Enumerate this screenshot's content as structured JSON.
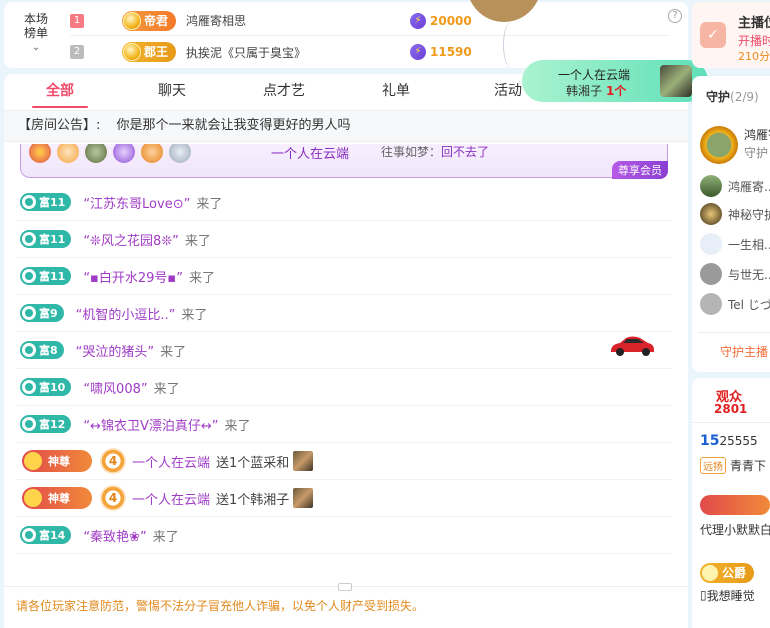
{
  "rank": {
    "title": "本场\n榜单",
    "title_line1": "本场",
    "title_line2": "榜单",
    "chevron": "⌄",
    "help": "?",
    "rows": [
      {
        "num": "1",
        "badge": "帝君",
        "name": "鸿雁寄相思",
        "score": "20000"
      },
      {
        "num": "2",
        "badge": "郡王",
        "name": "执挨泥《只属于臭宝》",
        "score": "11590"
      }
    ]
  },
  "tabs": [
    "全部",
    "聊天",
    "点才艺",
    "礼单",
    "活动"
  ],
  "active_tab": "全部",
  "announcement": {
    "label": "【房间公告】:",
    "text": "你是那个一来就会让我变得更好的男人吗"
  },
  "vip_banner": {
    "user": "一个人在云端",
    "msg_prefix": "往事如梦：",
    "msg_text": "回不去了",
    "tag": "尊享会员"
  },
  "messages": [
    {
      "type": "enter",
      "fu": "富11",
      "user": "“江苏东哥Love⊙”",
      "action": "来了"
    },
    {
      "type": "enter",
      "fu": "富11",
      "user": "“❊风之花园8❊”",
      "action": "来了"
    },
    {
      "type": "enter",
      "fu": "富11",
      "user": "“▪白开水29号▪”",
      "action": "来了"
    },
    {
      "type": "enter",
      "fu": "富9",
      "user": "“机智的小逗比..”",
      "action": "来了"
    },
    {
      "type": "enter",
      "fu": "富8",
      "user": "“哭泣的猪头”",
      "action": "来了"
    },
    {
      "type": "enter",
      "fu": "富10",
      "user": "“啸风008”",
      "action": "来了"
    },
    {
      "type": "enter",
      "fu": "富12",
      "user": "“↔锦衣卫V漂泊真仔↔”",
      "action": "来了"
    },
    {
      "type": "gift",
      "noble": "神尊",
      "level": "4",
      "user": "一个人在云端",
      "action": "送1个蓝采和"
    },
    {
      "type": "gift",
      "noble": "神尊",
      "level": "4",
      "user": "一个人在云端",
      "action": "送1个韩湘子"
    },
    {
      "type": "enter",
      "fu": "富14",
      "user": "“秦致艳❀”",
      "action": "来了"
    }
  ],
  "warning": "请各位玩家注意防范，警惕不法分子冒充他人诈骗，以免个人财产受到损失。",
  "toast": {
    "line1": "一个人在云端",
    "gift": "韩湘子",
    "count": "1个"
  },
  "side": {
    "anchor_title": "主播位",
    "anchor_sub": "开播时",
    "anchor_time": "210分",
    "guard_title": "守护",
    "guard_count": "(2/9)",
    "guard_first_name": "鸿雁寄",
    "guard_first_sub": "守护",
    "guards": [
      "鸿雁寄...",
      "神秘守护",
      "一生相...",
      "与世无...",
      "Tel じづ..."
    ],
    "open_guard": "守护主播",
    "arrow": "›",
    "audience_label": "观众",
    "audience_count": "2801",
    "aud_rows": [
      {
        "prefix": "15",
        "text": "25555"
      },
      {
        "tag": "远扬",
        "text": "青青下"
      },
      {
        "text": ""
      },
      {
        "text": "代理小默默白"
      },
      {
        "badge": "公爵"
      },
      {
        "text": "我想睡觉"
      }
    ]
  },
  "colors": {
    "accent": "#f04b6b",
    "username": "#a03cc6",
    "fu_badge": "#2fb7a8",
    "warning": "#e08a1c",
    "score": "#f09a1a"
  }
}
